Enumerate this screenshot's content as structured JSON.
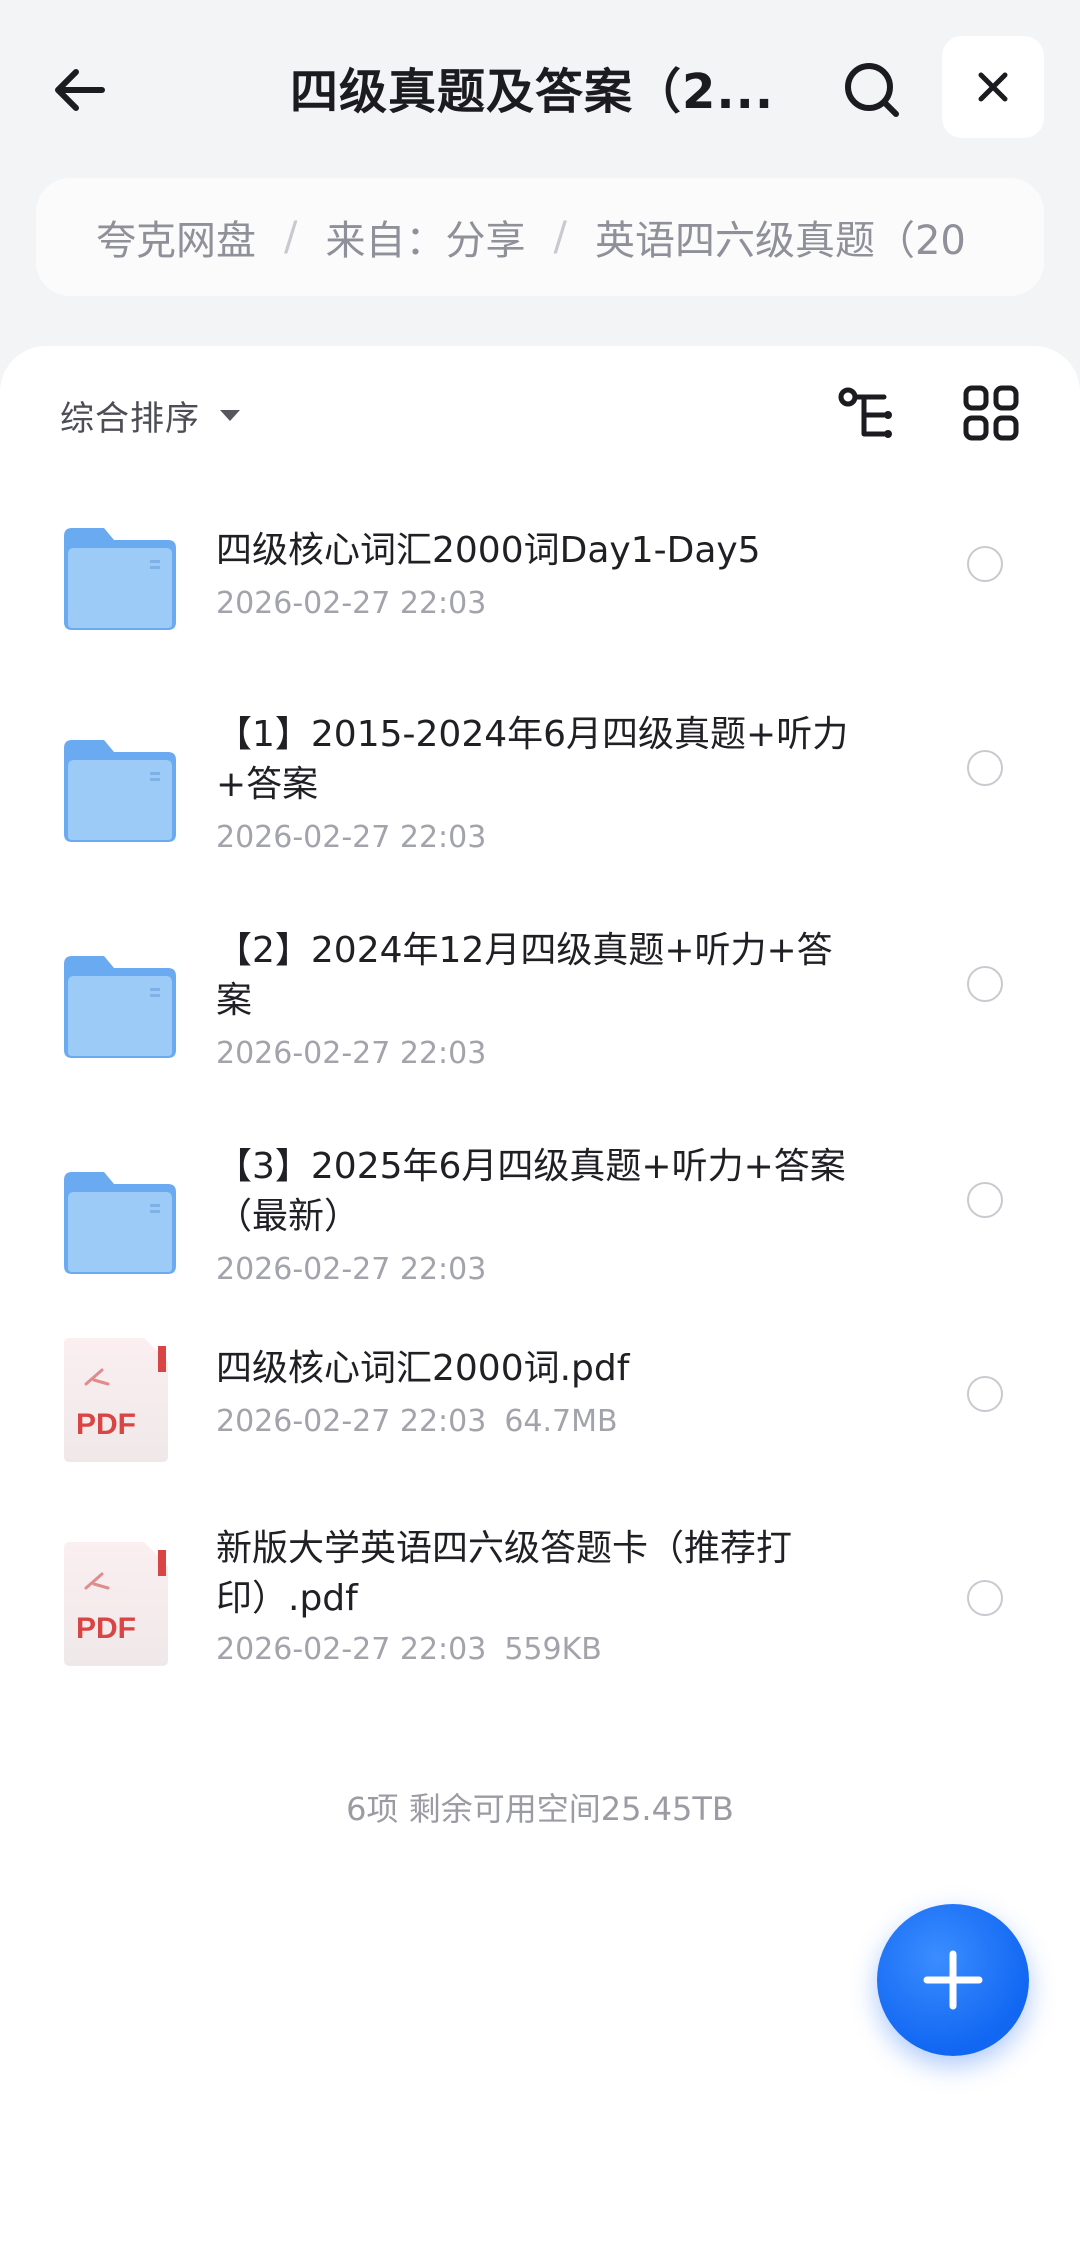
{
  "header": {
    "title": "四级真题及答案（2...",
    "back_icon": "arrow-left-icon",
    "search_icon": "search-icon",
    "close_icon": "close-icon"
  },
  "breadcrumb": [
    "夸克网盘",
    "来自：分享",
    "英语四六级真题（20"
  ],
  "toolbar": {
    "sort_label": "综合排序"
  },
  "files": [
    {
      "type": "folder",
      "name": "四级核心词汇2000词Day1-Day5",
      "date": "2026-02-27 22:03",
      "size": ""
    },
    {
      "type": "folder",
      "name": "【1】2015-2024年6月四级真题+听力+答案",
      "date": "2026-02-27 22:03",
      "size": ""
    },
    {
      "type": "folder",
      "name": "【2】2024年12月四级真题+听力+答案",
      "date": "2026-02-27 22:03",
      "size": ""
    },
    {
      "type": "folder",
      "name": "【3】2025年6月四级真题+听力+答案（最新）",
      "date": "2026-02-27 22:03",
      "size": ""
    },
    {
      "type": "pdf",
      "name": "四级核心词汇2000词.pdf",
      "date": "2026-02-27 22:03",
      "size": "64.7MB",
      "badge": "PDF"
    },
    {
      "type": "pdf",
      "name": "新版大学英语四六级答题卡（推荐打印）.pdf",
      "date": "2026-02-27 22:03",
      "size": "559KB",
      "badge": "PDF"
    }
  ],
  "footer": {
    "summary": "6项 剩余可用空间25.45TB"
  },
  "colors": {
    "accent": "#1167f2",
    "folder": "#7fb8f3",
    "pdf_red": "#d94545"
  }
}
